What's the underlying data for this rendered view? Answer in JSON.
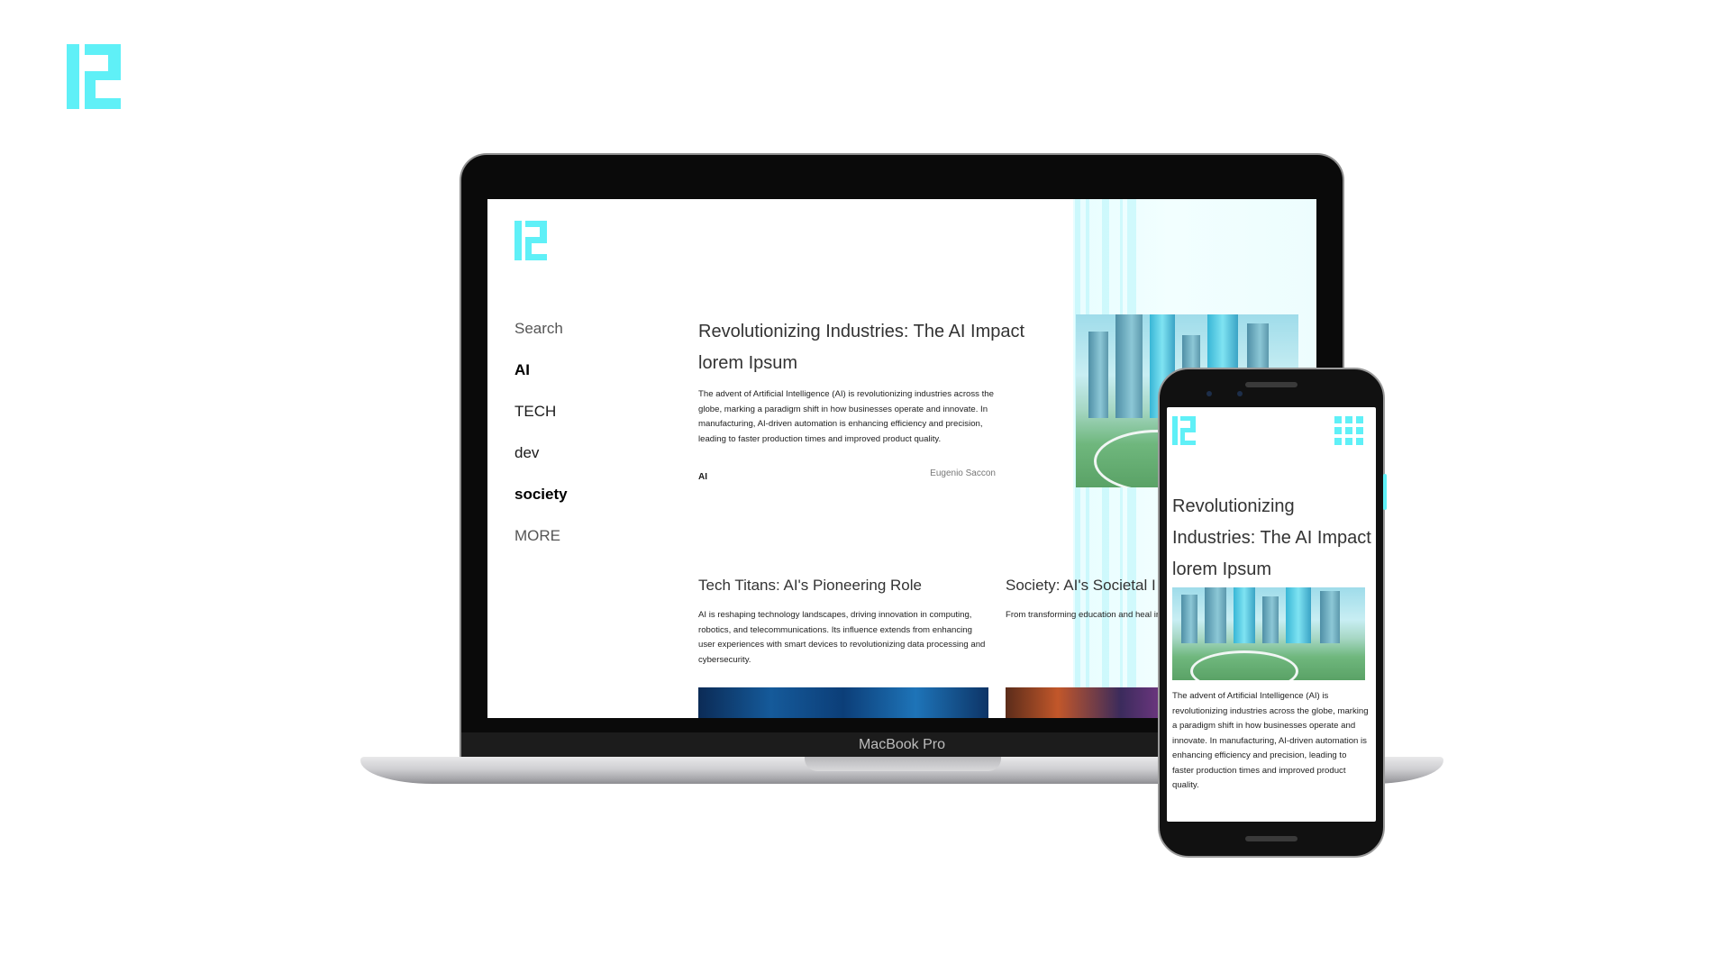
{
  "brand": {
    "accent_color": "#5ff0f7",
    "logo_icon": "bracket-e-logo-icon"
  },
  "device": {
    "laptop_label": "MacBook Pro"
  },
  "site": {
    "nav": [
      {
        "label": "Search",
        "weight": "light"
      },
      {
        "label": "AI",
        "weight": "bold"
      },
      {
        "label": "TECH",
        "weight": "normal"
      },
      {
        "label": "dev",
        "weight": "normal"
      },
      {
        "label": "society",
        "weight": "bold"
      },
      {
        "label": "MORE",
        "weight": "light"
      }
    ],
    "feature": {
      "title": "Revolutionizing Industries: The AI Impact lorem Ipsum",
      "body": "The advent of Artificial Intelligence (AI) is revolutionizing industries across the globe, marking a paradigm shift in how businesses operate and innovate. In manufacturing, AI-driven automation is enhancing efficiency and precision, leading to faster production times and improved product quality.",
      "tag": "AI",
      "author": "Eugenio Saccon"
    },
    "cards": [
      {
        "title": "Tech Titans: AI's Pioneering Role",
        "body": "AI is reshaping technology landscapes, driving innovation in computing, robotics, and telecommunications. Its influence extends from enhancing user experiences with smart devices to revolutionizing data processing and cybersecurity."
      },
      {
        "title": "Society: AI's Societal I",
        "body": "From transforming education and heal interactions and governance. Its ability data sets offers insights that drive poli initiatives"
      }
    ]
  },
  "mobile": {
    "menu_icon": "grid-menu-icon",
    "title": "Revolutionizing Industries: The AI Impact lorem Ipsum",
    "body": "The advent of Artificial Intelligence (AI) is revolutionizing industries across the globe, marking a paradigm shift in how businesses operate and innovate. In manufacturing, AI-driven automation is enhancing efficiency and precision, leading to faster production times and improved product quality."
  }
}
